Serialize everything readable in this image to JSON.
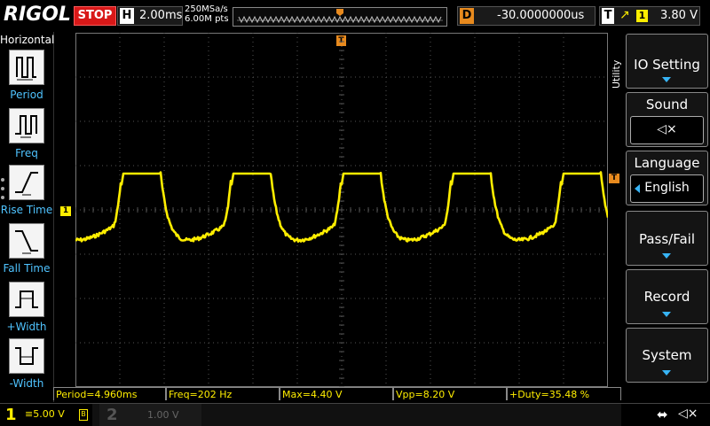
{
  "brand": {
    "logo": "RIGOL"
  },
  "status": {
    "run_state": "STOP"
  },
  "horizontal": {
    "label": "H",
    "timebase": "2.00ms",
    "sample_rate": "250MSa/s",
    "memory_depth": "6.00M pts"
  },
  "delay": {
    "label": "D",
    "value": "-30.0000000us"
  },
  "trigger": {
    "label": "T",
    "edge_icon": "rising-edge-icon",
    "source": "1",
    "level": "3.80 V",
    "marker": "T"
  },
  "left_menu": {
    "title": "Horizontal",
    "items": [
      {
        "label": "Period",
        "icon": "period-icon"
      },
      {
        "label": "Freq",
        "icon": "freq-icon"
      },
      {
        "label": "Rise Time",
        "icon": "rise-time-icon"
      },
      {
        "label": "Fall Time",
        "icon": "fall-time-icon"
      },
      {
        "label": "+Width",
        "icon": "pos-width-icon"
      },
      {
        "label": "-Width",
        "icon": "neg-width-icon"
      }
    ]
  },
  "right_menu": {
    "section_label": "Utility",
    "items": [
      {
        "label": "IO Setting",
        "type": "arrow"
      },
      {
        "label": "Sound",
        "type": "value",
        "value_icon": "speaker-mute-icon",
        "value_text": "◁×"
      },
      {
        "label": "Language",
        "type": "value",
        "value_text": "English"
      },
      {
        "label": "Pass/Fail",
        "type": "arrow"
      },
      {
        "label": "Record",
        "type": "arrow"
      },
      {
        "label": "System",
        "type": "arrow"
      }
    ]
  },
  "measurements": [
    {
      "text": "Period=4.960ms"
    },
    {
      "text": "Freq=202 Hz"
    },
    {
      "text": "Max=4.40 V"
    },
    {
      "text": "Vpp=8.20 V"
    },
    {
      "text": "+Duty=35.48 %"
    }
  ],
  "channels": {
    "ch1": {
      "number": "1",
      "scale": "5.00 V",
      "bw_icon": "bandwidth-limit-icon",
      "marker": "1"
    },
    "ch2": {
      "number": "2",
      "scale": "1.00 V"
    }
  },
  "status_icons": {
    "usb": "usb-icon",
    "sound": "speaker-mute-icon"
  },
  "colors": {
    "ch1": "#ffee00",
    "stop": "#d81818",
    "trigger": "#e88a1e",
    "menu_text_accent": "#37b4f5",
    "grid": "#555555"
  },
  "chart_data": {
    "type": "line",
    "grid": {
      "h_divisions": 12,
      "v_divisions": 8,
      "on": true
    },
    "x_unit": "ms",
    "x_per_division": 2.0,
    "y_unit": "V",
    "y_per_division": 5.0,
    "waveform_ch1": {
      "period_ms": 4.96,
      "max_v": 4.4,
      "vpp_v": 8.2,
      "positive_duty_percent": 35.48
    }
  }
}
